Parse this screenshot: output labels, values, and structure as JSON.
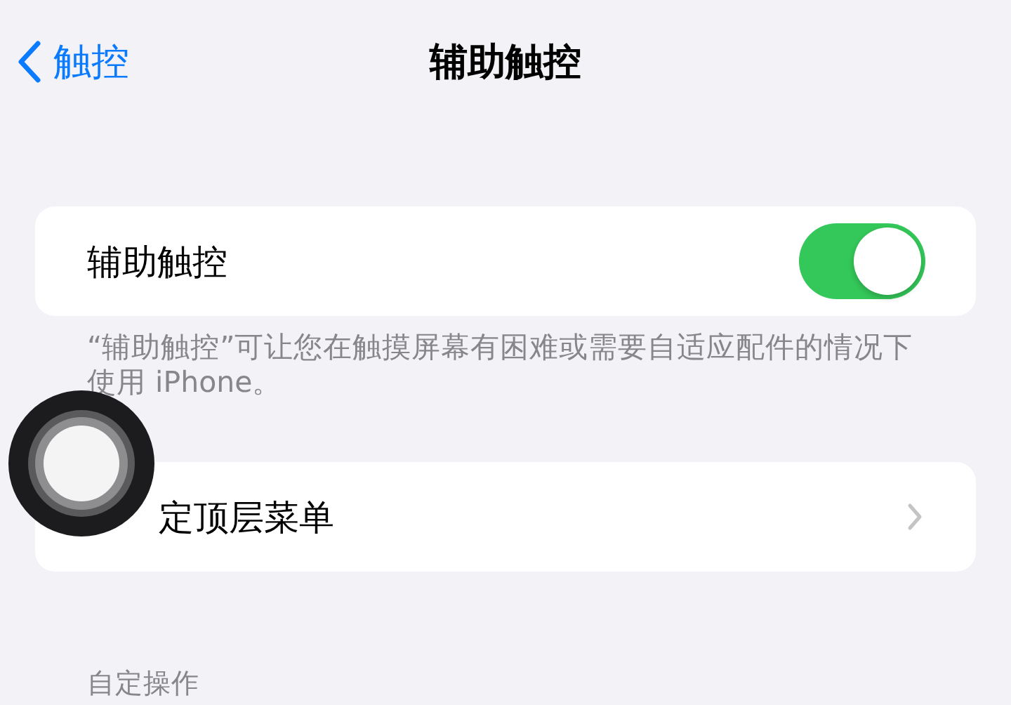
{
  "nav": {
    "back_label": "触控",
    "title": "辅助触控"
  },
  "toggle_row": {
    "label": "辅助触控",
    "on": true
  },
  "footer": "“辅助触控”可让您在触摸屏幕有困难或需要自适应配件的情况下使用 iPhone。",
  "menu_row": {
    "label": "定顶层菜单"
  },
  "section_header": "自定操作"
}
